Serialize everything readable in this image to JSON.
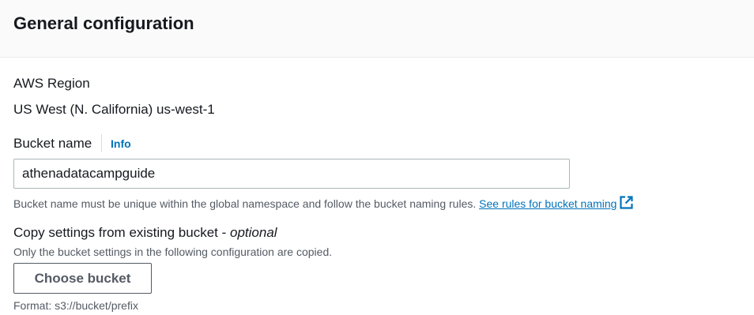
{
  "header": {
    "title": "General configuration"
  },
  "region": {
    "label": "AWS Region",
    "value": "US West (N. California) us-west-1"
  },
  "bucket_name": {
    "label": "Bucket name",
    "info_link": "Info",
    "value": "athenadatacampguide",
    "hint": "Bucket name must be unique within the global namespace and follow the bucket naming rules.",
    "rules_link": "See rules for bucket naming",
    "rules_icon": "external-link-icon"
  },
  "copy_settings": {
    "label": "Copy settings from existing bucket -",
    "optional": "optional",
    "hint": "Only the bucket settings in the following configuration are copied.",
    "button_label": "Choose bucket",
    "format_hint": "Format: s3://bucket/prefix"
  },
  "colors": {
    "link": "#0073bb",
    "text": "#16191f",
    "secondary_text": "#545b64",
    "header_bg": "#fafafa"
  }
}
